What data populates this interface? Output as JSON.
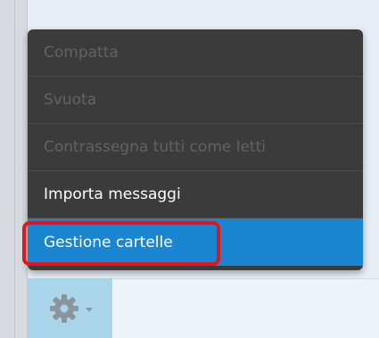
{
  "menu": {
    "items": [
      {
        "label": "Compatta",
        "state": "disabled"
      },
      {
        "label": "Svuota",
        "state": "disabled"
      },
      {
        "label": "Contrassegna tutti come letti",
        "state": "disabled"
      },
      {
        "label": "Importa messaggi",
        "state": "enabled"
      },
      {
        "label": "Gestione cartelle",
        "state": "highlighted"
      }
    ]
  },
  "toolbar": {
    "gear_icon": "gear-icon",
    "dropdown_icon": "caret-down-icon"
  },
  "colors": {
    "menu_background": "#3b3b3b",
    "menu_disabled_text": "#626262",
    "menu_active_background": "#1a86d1",
    "highlight_border": "#e3151c",
    "gear_button_background": "#a9d6ea"
  }
}
